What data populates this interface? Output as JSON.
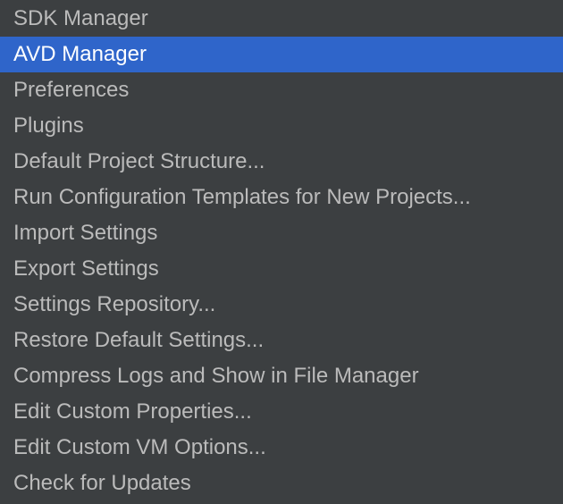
{
  "menu": {
    "selected_index": 1,
    "colors": {
      "background": "#3c3f41",
      "text": "#bbbbbb",
      "selected_background": "#2f65ca",
      "selected_text": "#ffffff"
    },
    "items": [
      {
        "label": "SDK Manager"
      },
      {
        "label": "AVD Manager"
      },
      {
        "label": "Preferences"
      },
      {
        "label": "Plugins"
      },
      {
        "label": "Default Project Structure..."
      },
      {
        "label": "Run Configuration Templates for New Projects..."
      },
      {
        "label": "Import Settings"
      },
      {
        "label": "Export Settings"
      },
      {
        "label": "Settings Repository..."
      },
      {
        "label": "Restore Default Settings..."
      },
      {
        "label": "Compress Logs and Show in File Manager"
      },
      {
        "label": "Edit Custom Properties..."
      },
      {
        "label": "Edit Custom VM Options..."
      },
      {
        "label": "Check for Updates"
      }
    ]
  }
}
